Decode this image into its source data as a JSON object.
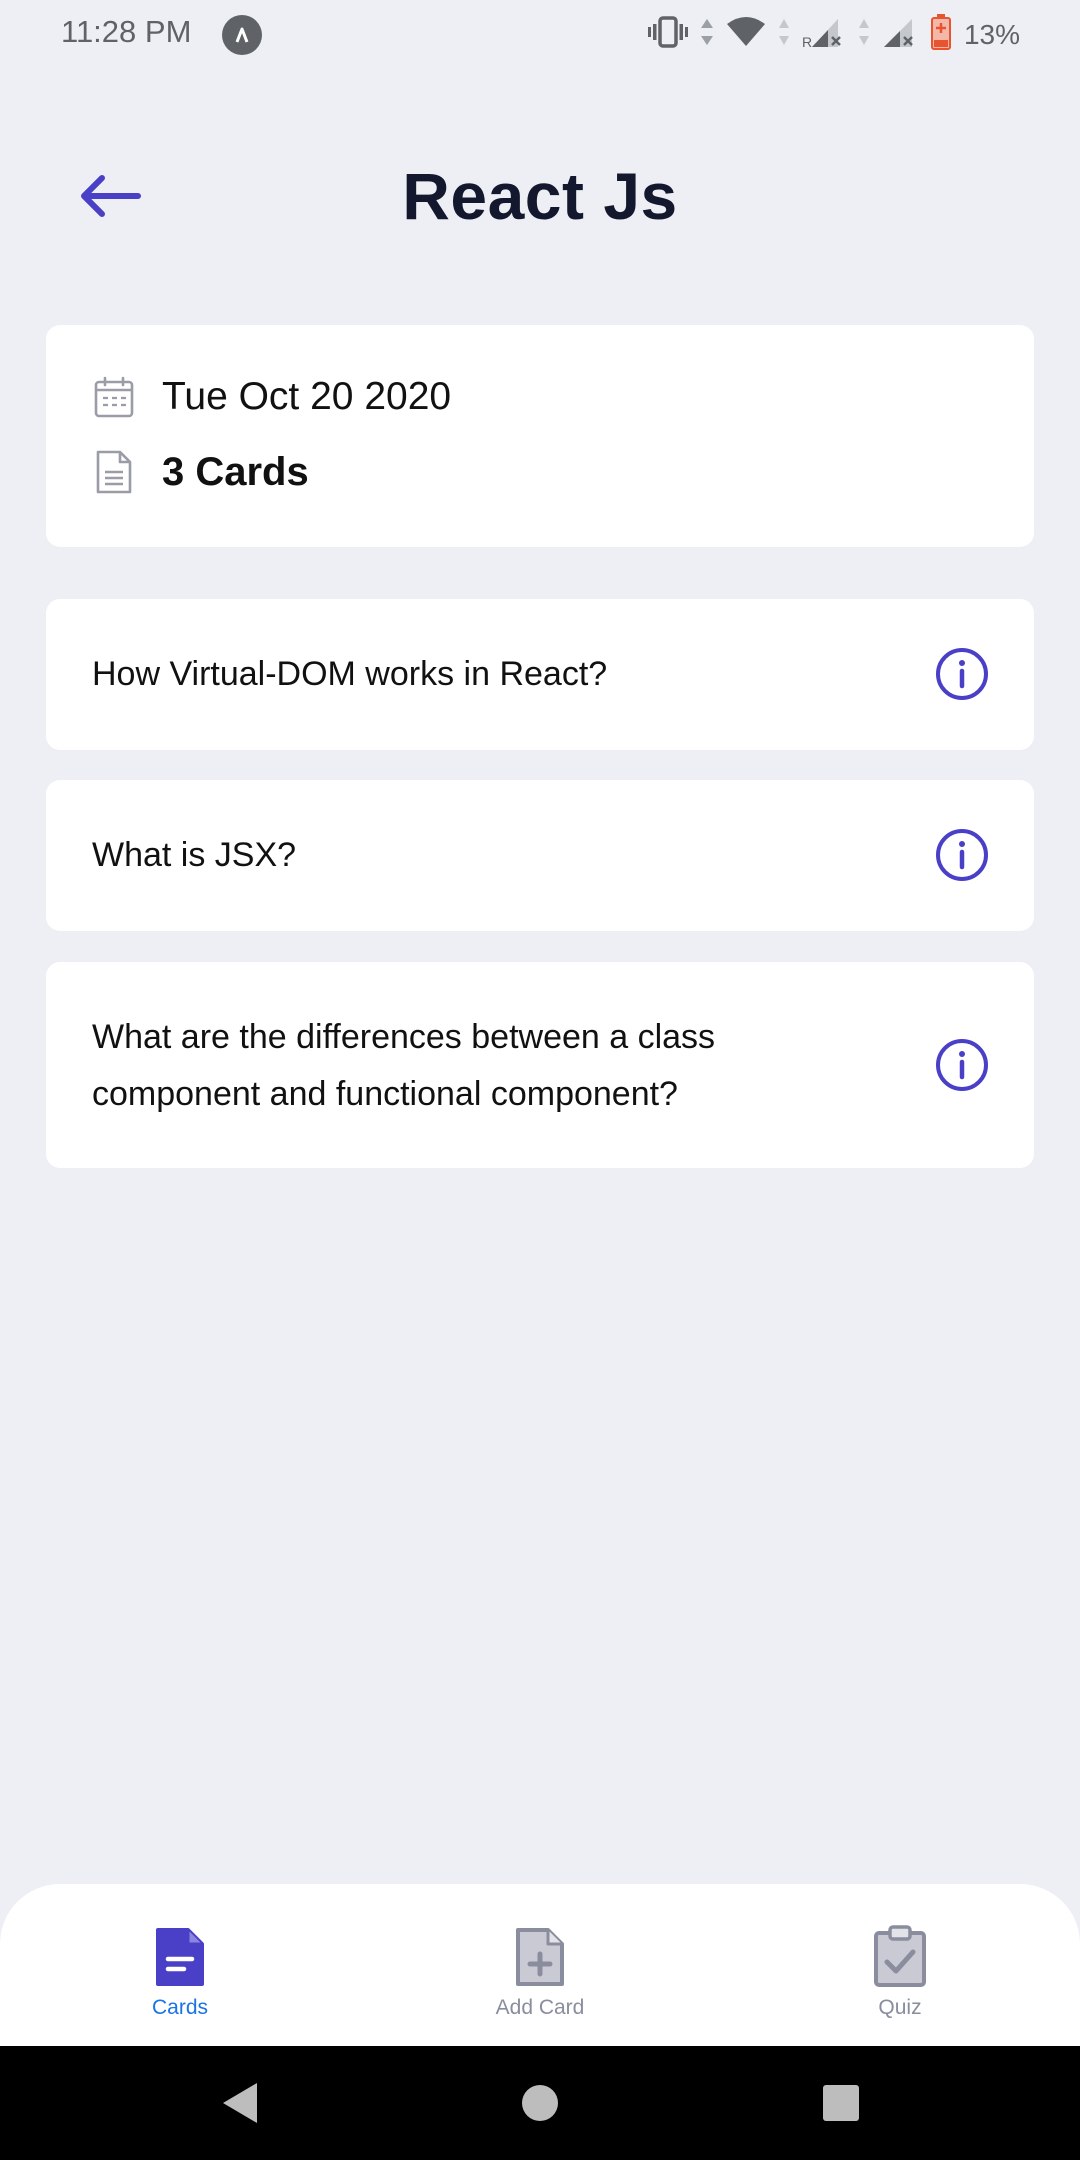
{
  "status_bar": {
    "time": "11:28 PM",
    "battery_percent": "13%",
    "icons": [
      "app-notification-icon",
      "vibrate-icon",
      "data-arrows-icon",
      "wifi-icon",
      "signal-r-icon",
      "signal-icon",
      "battery-icon"
    ]
  },
  "header": {
    "title": "React Js",
    "back_icon": "arrow-left-icon"
  },
  "info": {
    "date": "Tue Oct 20 2020",
    "count": "3 Cards",
    "date_icon": "calendar-icon",
    "count_icon": "document-icon"
  },
  "cards": [
    {
      "question": "How Virtual-DOM works in React?"
    },
    {
      "question": "What is JSX?"
    },
    {
      "question": "What are the differences between a class component and functional component?"
    }
  ],
  "bottom_nav": {
    "items": [
      {
        "label": "Cards",
        "icon": "document-icon",
        "active": true
      },
      {
        "label": "Add Card",
        "icon": "add-document-icon",
        "active": false
      },
      {
        "label": "Quiz",
        "icon": "clipboard-check-icon",
        "active": false
      }
    ]
  },
  "colors": {
    "background": "#EEEFF4",
    "accent": "#4A3FC7",
    "nav_active": "#1A73E8",
    "nav_inactive": "#8A8D9E",
    "title": "#14182E"
  }
}
